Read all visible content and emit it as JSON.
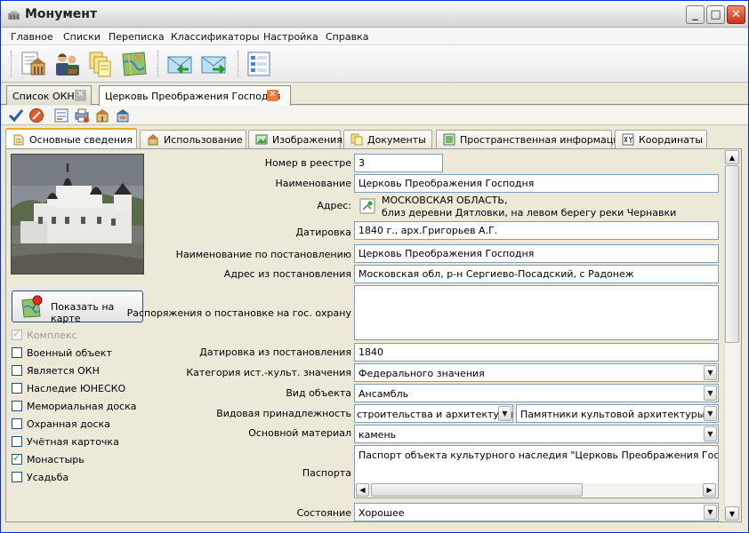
{
  "window": {
    "title": "Монумент"
  },
  "menu": [
    "Главное",
    "Списки",
    "Переписка",
    "Классификаторы",
    "Настройка",
    "Справка"
  ],
  "toolbar": {
    "icons": [
      "registry-icon",
      "users-icon",
      "documents-icon",
      "map-icon",
      "mail-incoming-icon",
      "mail-outgoing-icon",
      "list-icon"
    ]
  },
  "doc_tabs": [
    {
      "label": "Список ОКН"
    },
    {
      "label": "Церковь Преображения Господня"
    }
  ],
  "section_tabs": [
    {
      "label": "Основные сведения",
      "icon": "info-icon"
    },
    {
      "label": "Использование",
      "icon": "building-icon"
    },
    {
      "label": "Изображения",
      "icon": "image-icon"
    },
    {
      "label": "Документы",
      "icon": "documents-icon"
    },
    {
      "label": "Пространственная информация",
      "icon": "spatial-icon"
    },
    {
      "label": "Координаты",
      "icon": "coordinates-icon"
    }
  ],
  "map_button": {
    "label": "Показать на карте"
  },
  "checkboxes": [
    {
      "label": "Комплекс",
      "checked": true,
      "disabled": true
    },
    {
      "label": "Военный объект",
      "checked": false
    },
    {
      "label": "Является ОКН",
      "checked": false
    },
    {
      "label": "Наследие ЮНЕСКО",
      "checked": false
    },
    {
      "label": "Мемориальная доска",
      "checked": false
    },
    {
      "label": "Охранная доска",
      "checked": false
    },
    {
      "label": "Учётная карточка",
      "checked": false
    },
    {
      "label": "Монастырь",
      "checked": true
    },
    {
      "label": "Усадьба",
      "checked": false
    }
  ],
  "fields": {
    "registry_number": {
      "label": "Номер в реестре",
      "value": "3"
    },
    "name": {
      "label": "Наименование",
      "value": "Церковь Преображения Господня"
    },
    "address": {
      "label": "Адрес:",
      "line1": "МОСКОВСКАЯ ОБЛАСТЬ,",
      "line2": "близ деревни Дятловки, на левом берегу реки Чернавки"
    },
    "dating": {
      "label": "Датировка",
      "value": "1840 г., арх.Григорьев А.Г."
    },
    "name_decree": {
      "label": "Наименование по постановлению",
      "value": "Церковь Преображения Господня"
    },
    "address_decree": {
      "label": "Адрес из постановления",
      "value": "Московская обл, р-н Сергиево-Посадский, с Радонеж"
    },
    "protection_orders": {
      "label": "Распоряжения о постановке на гос. охрану",
      "value": ""
    },
    "dating_decree": {
      "label": "Датировка из постановления",
      "value": "1840"
    },
    "category": {
      "label": "Категория ист.-культ. значения",
      "value": "Федерального значения"
    },
    "object_type": {
      "label": "Вид объекта",
      "value": "Ансамбль"
    },
    "species": {
      "label": "Видовая принадлежность",
      "value1": "строительства и архитектуры",
      "value2": "Памятники культовой архитектуры"
    },
    "material": {
      "label": "Основной материал",
      "value": "камень"
    },
    "passport": {
      "label": "Паспорта",
      "value": "Паспорт объекта культурного наследия   \"Церковь Преображения Господня с."
    },
    "state": {
      "label": "Состояние",
      "value": "Хорошее"
    }
  }
}
